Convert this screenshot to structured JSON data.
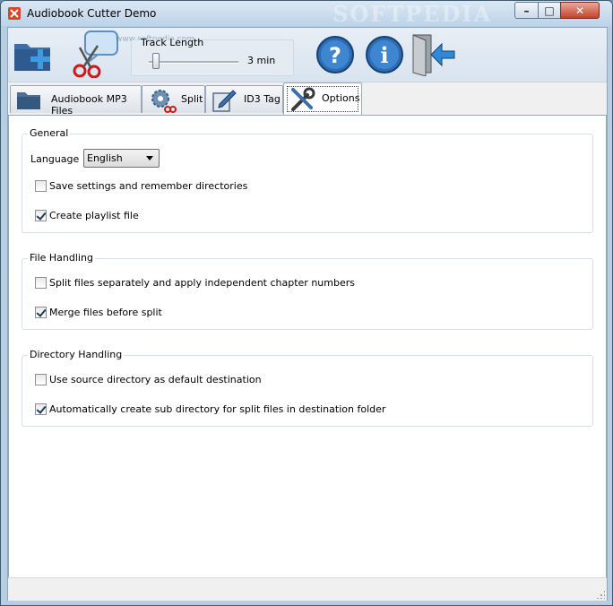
{
  "window": {
    "title": "Audiobook Cutter Demo",
    "watermark": "SOFTPEDIA",
    "controls": {
      "minimize": "–",
      "maximize": "□",
      "close": "✕"
    }
  },
  "toolbar": {
    "add_files_icon": "folder-add-icon",
    "split_icon": "scissors-icon",
    "track_length": {
      "label": "Track Length",
      "value": "3 min",
      "slider_fraction": 0.05
    },
    "help_icon": "help-icon",
    "info_icon": "info-icon",
    "exit_icon": "exit-door-icon",
    "overlay_text": "www.softpedia.com"
  },
  "tabs": [
    {
      "label": "Audiobook MP3 Files",
      "icon": "folder-icon",
      "active": false
    },
    {
      "label": "Split",
      "icon": "gear-scissors-icon",
      "active": false
    },
    {
      "label": "ID3 Tag",
      "icon": "pencil-icon",
      "active": false
    },
    {
      "label": "Options",
      "icon": "tools-icon",
      "active": true
    }
  ],
  "options": {
    "general": {
      "title": "General",
      "language_label": "Language",
      "language_value": "English",
      "save_settings": {
        "label": "Save settings and remember directories",
        "checked": false
      },
      "create_playlist": {
        "label": "Create playlist file",
        "checked": true
      }
    },
    "file_handling": {
      "title": "File Handling",
      "split_separately": {
        "label": "Split files separately and apply independent chapter numbers",
        "checked": false
      },
      "merge_files": {
        "label": "Merge files before split",
        "checked": true
      }
    },
    "directory_handling": {
      "title": "Directory Handling",
      "use_source": {
        "label": "Use source directory as default destination",
        "checked": false
      },
      "auto_subdir": {
        "label": "Automatically create sub directory for split files in destination folder",
        "checked": true
      }
    }
  },
  "colors": {
    "accent_blue": "#2d6bb5",
    "close_red": "#c7402a"
  }
}
